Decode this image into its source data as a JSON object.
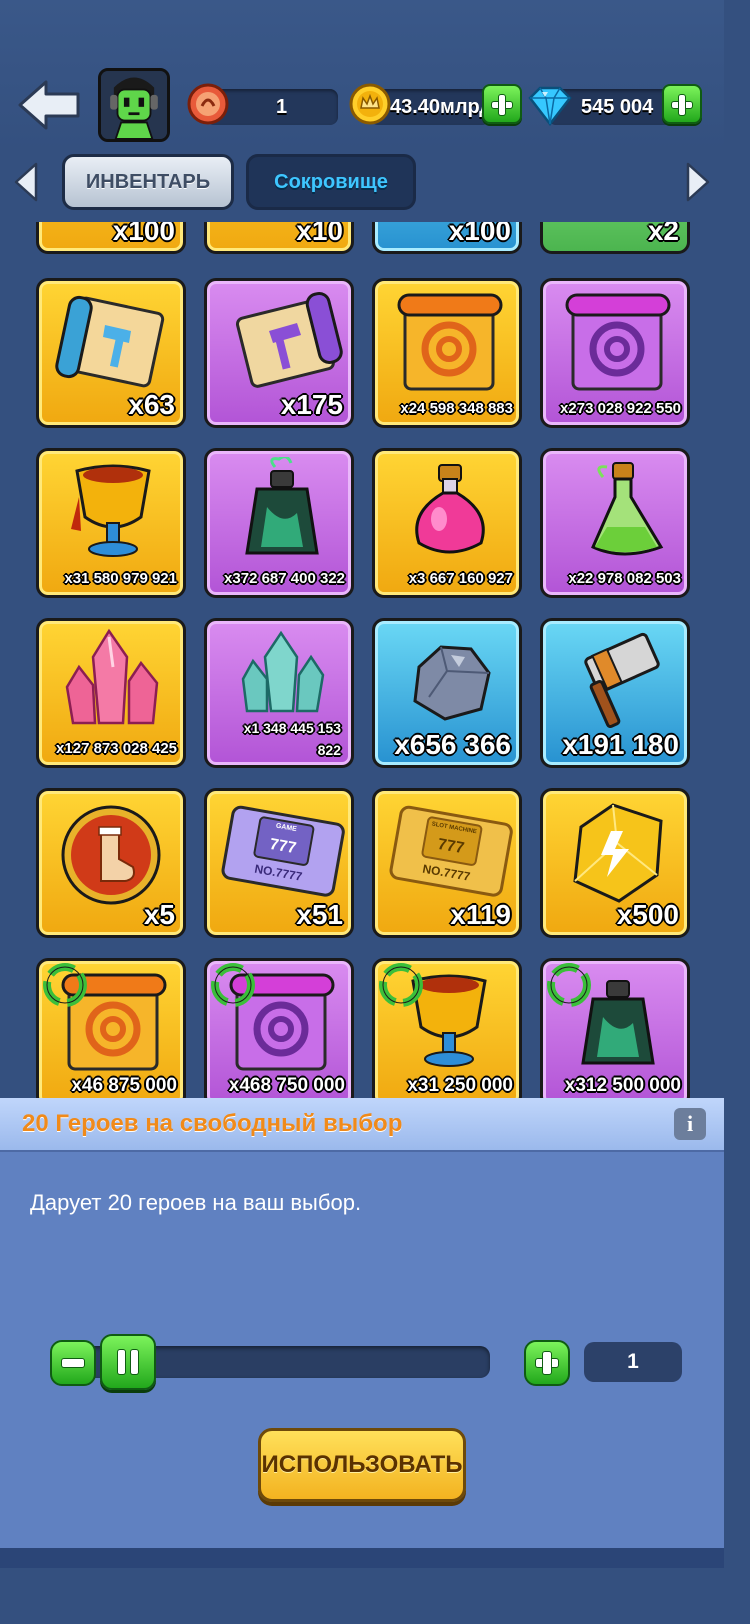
{
  "topbar": {
    "level_value": "1",
    "gold_value": "43.40млрд",
    "gems_value": "545 004"
  },
  "tabs": [
    {
      "label": "ИНВЕНТАРЬ",
      "active": true
    },
    {
      "label": "Сокровище",
      "active": false
    }
  ],
  "inventory": {
    "partial_row": [
      "x100",
      "x10",
      "x100",
      "x2"
    ],
    "items": [
      {
        "icon": "blue-hammer-scroll-icon",
        "qty": "x63"
      },
      {
        "icon": "purple-hammer-scroll-icon",
        "qty": "x175"
      },
      {
        "icon": "orange-swirl-scroll-icon",
        "qty": "x24 598 348 883"
      },
      {
        "icon": "purple-swirl-scroll-icon",
        "qty": "x273 028 922 550"
      },
      {
        "icon": "golden-goblet-icon",
        "qty": "x31 580 979 921"
      },
      {
        "icon": "green-potion-bottle-icon",
        "qty": "x372 687 400 322"
      },
      {
        "icon": "pink-potion-flask-icon",
        "qty": "x3 667 160 927"
      },
      {
        "icon": "green-potion-vial-icon",
        "qty": "x22 978 082 503"
      },
      {
        "icon": "pink-crystal-icon",
        "qty": "x127 873 028 425"
      },
      {
        "icon": "teal-crystal-icon",
        "qty": "x1 348 445 153 822"
      },
      {
        "icon": "stone-ore-icon",
        "qty": "x656 366"
      },
      {
        "icon": "hammer-icon",
        "qty": "x191 180"
      },
      {
        "icon": "sock-coin-icon",
        "qty": "x5"
      },
      {
        "icon": "purple-slot-ticket-icon",
        "qty": "x51",
        "ticket_top": "GAME",
        "ticket_num": "NO.7777"
      },
      {
        "icon": "gold-slot-ticket-icon",
        "qty": "x119",
        "ticket_top": "SLOT MACHINE",
        "ticket_num": "NO.7777"
      },
      {
        "icon": "lightning-gem-icon",
        "qty": "x500"
      },
      {
        "icon": "recycled-orange-scroll-icon",
        "qty": "x46 875 000"
      },
      {
        "icon": "recycled-purple-scroll-icon",
        "qty": "x468 750 000"
      },
      {
        "icon": "recycled-goblet-icon",
        "qty": "x31 250 000"
      },
      {
        "icon": "recycled-green-bottle-icon",
        "qty": "x312 500 000"
      }
    ]
  },
  "panel": {
    "title": "20 Героев на свободный выбор",
    "info_label": "i",
    "description": "Дарует 20 героев на ваш выбор.",
    "quantity": "1",
    "slider_fraction": 0,
    "use_label": "ИСПОЛЬЗОВАТЬ"
  },
  "colors": {
    "background": "#34507f",
    "panel": "#6081c1",
    "title_orange": "#f08a1a",
    "accent_green": "#22a81c",
    "tab_blue_text": "#3ec6ff"
  }
}
